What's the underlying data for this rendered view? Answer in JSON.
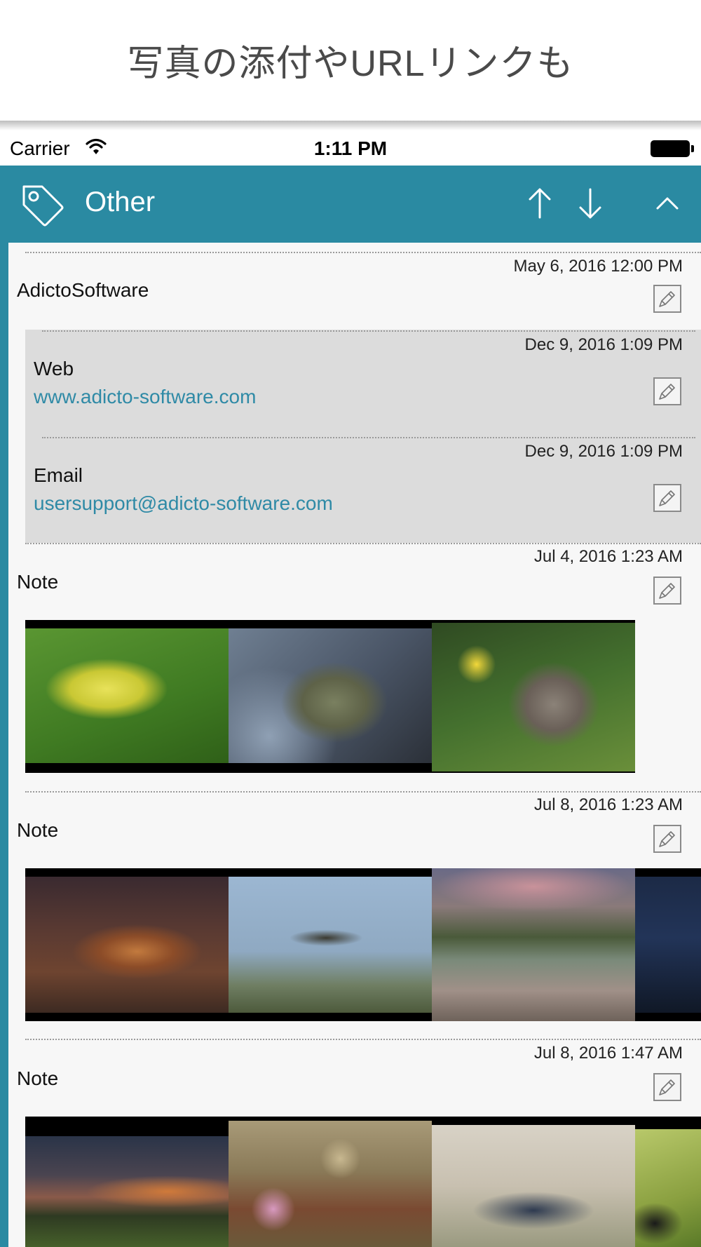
{
  "promo": {
    "headline": "写真の添付やURLリンクも"
  },
  "status_bar": {
    "carrier": "Carrier",
    "time": "1:11 PM"
  },
  "nav": {
    "title": "Other",
    "icons": [
      "tag-icon",
      "arrow-up-icon",
      "arrow-down-icon",
      "chevron-up-icon"
    ]
  },
  "colors": {
    "accent": "#2a8aa2",
    "link": "#2f8aa6",
    "sub_background": "#dcdcdc",
    "background": "#f7f7f7"
  },
  "entries": [
    {
      "date": "May 6, 2016 12:00 PM",
      "title": "AdictoSoftware",
      "children": [
        {
          "date": "Dec 9, 2016 1:09 PM",
          "title": "Web",
          "link": "www.adicto-software.com"
        },
        {
          "date": "Dec 9, 2016 1:09 PM",
          "title": "Email",
          "link": "usersupport@adicto-software.com"
        }
      ]
    },
    {
      "date": "Jul 4, 2016 1:23 AM",
      "title": "Note",
      "photos": [
        "daffodil-bud-photo",
        "frogs-photo",
        "cat-photo"
      ]
    },
    {
      "date": "Jul 8, 2016 1:23 AM",
      "title": "Note",
      "photos": [
        "canyon-photo",
        "dragonfly-photo",
        "mountain-lake-photo",
        "night-sky-photo"
      ]
    },
    {
      "date": "Jul 8, 2016 1:47 AM",
      "title": "Note",
      "photos": [
        "sunset-field-photo",
        "bird-on-plant-photo",
        "snake-photo",
        "bird-closeup-photo"
      ]
    }
  ]
}
